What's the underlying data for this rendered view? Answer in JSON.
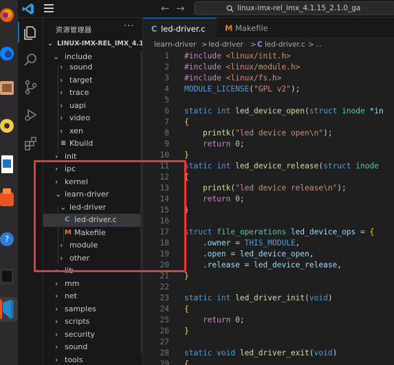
{
  "titlebar": {
    "back_arrow": "←",
    "forward_arrow": "→",
    "search_text": "linux-imx-rel_imx_4.1.15_2.1.0_ga"
  },
  "sidebar": {
    "title": "资源管理器",
    "more": "···",
    "root_label": "LINUX-IMX-REL_IMX_4.1.1...",
    "items": [
      {
        "label": "include",
        "chev": "⌄"
      },
      {
        "label": "sound",
        "chev": "›"
      },
      {
        "label": "target",
        "chev": "›"
      },
      {
        "label": "trace",
        "chev": "›"
      },
      {
        "label": "uapi",
        "chev": "›"
      },
      {
        "label": "video",
        "chev": "›"
      },
      {
        "label": "xen",
        "chev": "›"
      },
      {
        "label": "Kbuild",
        "icon": "≡"
      },
      {
        "label": "init",
        "chev": "›"
      },
      {
        "label": "ipc",
        "chev": "›"
      },
      {
        "label": "kernel",
        "chev": "›"
      },
      {
        "label": "learn-driver",
        "chev": "⌄"
      },
      {
        "label": "led-driver",
        "chev": "⌄"
      },
      {
        "label": "led-driver.c",
        "icon": "C"
      },
      {
        "label": "Makefile",
        "icon": "M"
      },
      {
        "label": "module",
        "chev": "›"
      },
      {
        "label": "other",
        "chev": "›"
      },
      {
        "label": "lib",
        "chev": "›"
      },
      {
        "label": "mm",
        "chev": "›"
      },
      {
        "label": "net",
        "chev": "›"
      },
      {
        "label": "samples",
        "chev": "›"
      },
      {
        "label": "scripts",
        "chev": "›"
      },
      {
        "label": "security",
        "chev": "›"
      },
      {
        "label": "sound",
        "chev": "›"
      },
      {
        "label": "tools",
        "chev": "›"
      }
    ]
  },
  "tabs": [
    {
      "icon": "C",
      "label": "led-driver.c"
    },
    {
      "icon": "M",
      "label": "Makefile"
    }
  ],
  "breadcrumb": {
    "p1": "learn-driver",
    "sep1": ">",
    "p2": "led-driver",
    "sep2": ">",
    "icon": "C",
    "p3": "led-driver.c",
    "sep3": ">",
    "p4": "..."
  },
  "editor": {
    "line_numbers": [
      "1",
      "2",
      "3",
      "4",
      "5",
      "6",
      "7",
      "8",
      "9",
      "10",
      "11",
      "12",
      "13",
      "14",
      "15",
      "16",
      "17",
      "18",
      "19",
      "20",
      "21",
      "22",
      "23",
      "24",
      "25",
      "26",
      "27",
      "28",
      "29"
    ],
    "tokens": {
      "l1a": "#include ",
      "l1b": "<linux/init.h>",
      "l2a": "#include ",
      "l2b": "<linux/module.h>",
      "l3a": "#include ",
      "l3b": "<linux/fs.h>",
      "l4a": "MODULE_LICENSE",
      "l4b": "(",
      "l4c": "\"GPL v2\"",
      "l4d": ");",
      "l6a": "static ",
      "l6b": "int ",
      "l6c": "led_device_open",
      "l6d": "(",
      "l6e": "struct ",
      "l6f": "inode ",
      "l6g": "*in",
      "l7": "{",
      "l8a": "    printk",
      "l8b": "(",
      "l8c": "\"led device open\\n\"",
      "l8d": ");",
      "l9a": "    return ",
      "l9b": "0",
      "l9c": ";",
      "l10": "}",
      "l11a": "static ",
      "l11b": "int ",
      "l11c": "led_device_release",
      "l11d": "(",
      "l11e": "struct ",
      "l11f": "inode ",
      "l12": "{",
      "l13a": "    printk",
      "l13b": "(",
      "l13c": "\"led device release\\n\"",
      "l13d": ");",
      "l14a": "    return ",
      "l14b": "0",
      "l14c": ";",
      "l15": "}",
      "l17a": "struct ",
      "l17b": "file_operations ",
      "l17c": "led_device_ops",
      "l17d": " = ",
      "l17e": "{",
      "l18a": "    .owner",
      "l18b": " = ",
      "l18c": "THIS_MODULE",
      "l18d": ",",
      "l19a": "    .open",
      "l19b": " = ",
      "l19c": "led_device_open",
      "l19d": ",",
      "l20a": "    .release",
      "l20b": " = ",
      "l20c": "led_device_release",
      "l20d": ",",
      "l21": "}",
      "l23a": "static ",
      "l23b": "int ",
      "l23c": "led_driver_init",
      "l23d": "(",
      "l23e": "void",
      "l23f": ")",
      "l24": "{",
      "l25a": "    return ",
      "l25b": "0",
      "l25c": ";",
      "l26": "}",
      "l28a": "static ",
      "l28b": "void ",
      "l28c": "led_driver_exit",
      "l28d": "(",
      "l28e": "void",
      "l28f": ")",
      "l29": "{"
    }
  },
  "colors": {
    "annotation": "#e5393f",
    "accent": "#0078d4"
  }
}
